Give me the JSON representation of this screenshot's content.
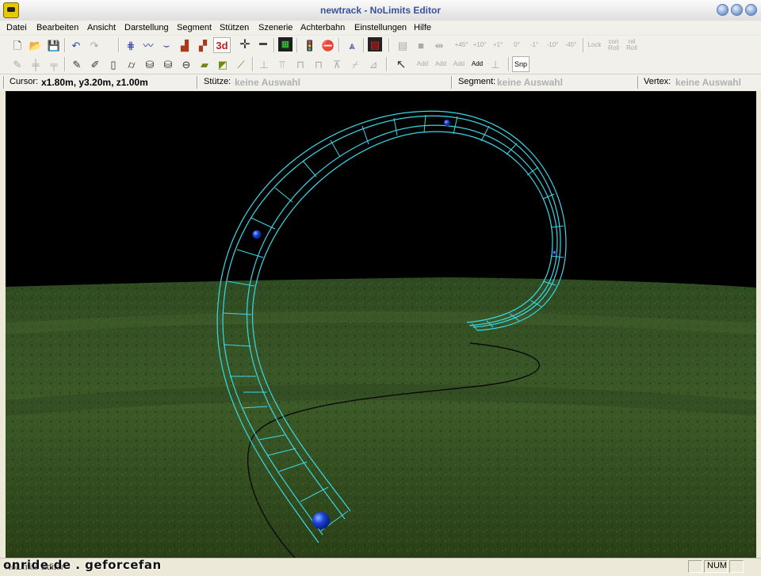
{
  "window": {
    "title": "newtrack - NoLimits Editor"
  },
  "menu": [
    "Datei",
    "Bearbeiten",
    "Ansicht",
    "Darstellung",
    "Segment",
    "Stützen",
    "Szenerie",
    "Achterbahn",
    "Einstellungen",
    "Hilfe"
  ],
  "toolbar1": {
    "view3d_label": "3d",
    "rot_plus45": "+45°",
    "rot_plus10": "+10°",
    "rot_plus1": "+1°",
    "rot_zero": "0°",
    "rot_minus1": "-1°",
    "rot_minus10": "-10°",
    "rot_minus45": "-45°",
    "lock_label": "Lock",
    "con_roll_label": "con Roll",
    "rel_roll_label": "rel Roll"
  },
  "toolbar2": {
    "add1_label": "Add",
    "add2_label": "Add",
    "add3_label": "Add",
    "add4_label": "Add",
    "snap_label": "Snp"
  },
  "info": {
    "cursor_label": "Cursor:",
    "cursor_value": "x1.80m, y3.20m, z1.00m",
    "stuetze_label": "Stütze:",
    "stuetze_value": "keine Auswahl",
    "segment_label": "Segment:",
    "segment_value": "keine Auswahl",
    "vertex_label": "Vertex:",
    "vertex_value": "keine Auswahl"
  },
  "status": {
    "left_text": "NoLimits Editor",
    "num_indicator": "NUM"
  },
  "watermark": "onride.de . geforcefan",
  "colors": {
    "track": "#3ad8e8",
    "node": "#1a44d8",
    "ground": "#2f4a1e",
    "sky": "#000000"
  }
}
